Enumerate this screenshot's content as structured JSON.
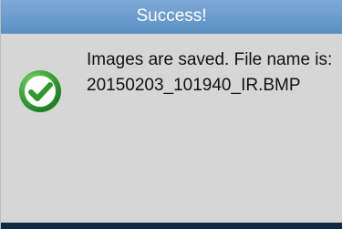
{
  "dialog": {
    "title": "Success!",
    "icon": "success-check-icon",
    "message": "Images are saved. File name is: 20150203_101940_IR.BMP"
  },
  "colors": {
    "title_bar": "#6d9bcd",
    "icon_green": "#3aa637",
    "bottom_bar": "#0f2a44"
  }
}
